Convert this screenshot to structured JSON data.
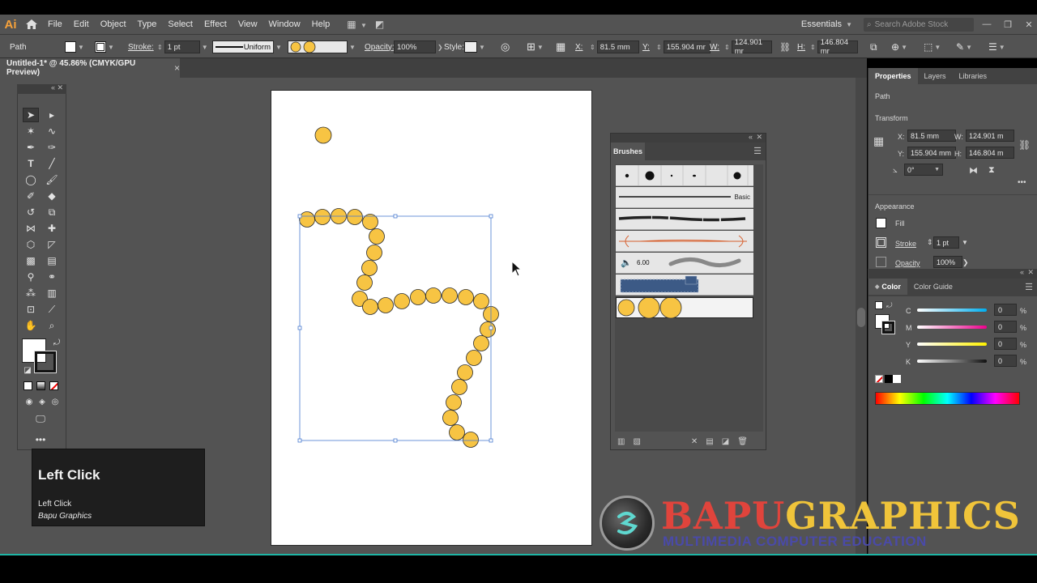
{
  "app": {
    "logo_text": "Ai"
  },
  "menu": [
    "File",
    "Edit",
    "Object",
    "Type",
    "Select",
    "Effect",
    "View",
    "Window",
    "Help"
  ],
  "workspace": {
    "label": "Essentials",
    "search_placeholder": "Search Adobe Stock"
  },
  "control": {
    "selection": "Path",
    "stroke_label": "Stroke:",
    "stroke_weight": "1 pt",
    "profile": "Uniform",
    "opacity_label": "Opacity:",
    "opacity": "100%",
    "style_label": "Style:",
    "x_label": "X:",
    "x": "81.5 mm",
    "y_label": "Y:",
    "y": "155.904 mr",
    "w_label": "W:",
    "w": "124.901 mr",
    "h_label": "H:",
    "h": "146.804 mr"
  },
  "document": {
    "tab_title": "Untitled-1* @ 45.86% (CMYK/GPU Preview)",
    "close": "×"
  },
  "tooltip": {
    "title": "Left Click",
    "line": "Left Click",
    "sub": "Bapu Graphics"
  },
  "brushes": {
    "title": "Brushes",
    "basic_label": "Basic",
    "size_label": "6.00"
  },
  "properties": {
    "tabs": [
      "Properties",
      "Layers",
      "Libraries"
    ],
    "selection": "Path",
    "transform_title": "Transform",
    "x_label": "X:",
    "x": "81.5 mm",
    "y_label": "Y:",
    "y": "155.904 mm",
    "w_label": "W:",
    "w": "124.901 m",
    "h_label": "H:",
    "h": "146.804 m",
    "angle": "0°",
    "appearance_title": "Appearance",
    "fill_label": "Fill",
    "stroke_label": "Stroke",
    "stroke_weight": "1 pt",
    "opacity_label": "Opacity",
    "opacity": "100%"
  },
  "color": {
    "tabs": [
      "Color",
      "Color Guide"
    ],
    "channels": [
      {
        "label": "C",
        "value": "0",
        "unit": "%"
      },
      {
        "label": "M",
        "value": "0",
        "unit": "%"
      },
      {
        "label": "Y",
        "value": "0",
        "unit": "%"
      },
      {
        "label": "K",
        "value": "0",
        "unit": "%"
      }
    ]
  },
  "brand": {
    "name_a": "BAPU",
    "name_b": "GRAPHICS",
    "tagline": "MULTIMEDIA COMPUTER EDUCATION"
  },
  "colors": {
    "dot_fill": "#f7c443",
    "dot_stroke": "#2a2a2a",
    "selection": "#4a7bd0",
    "ui_panel": "#535353"
  }
}
